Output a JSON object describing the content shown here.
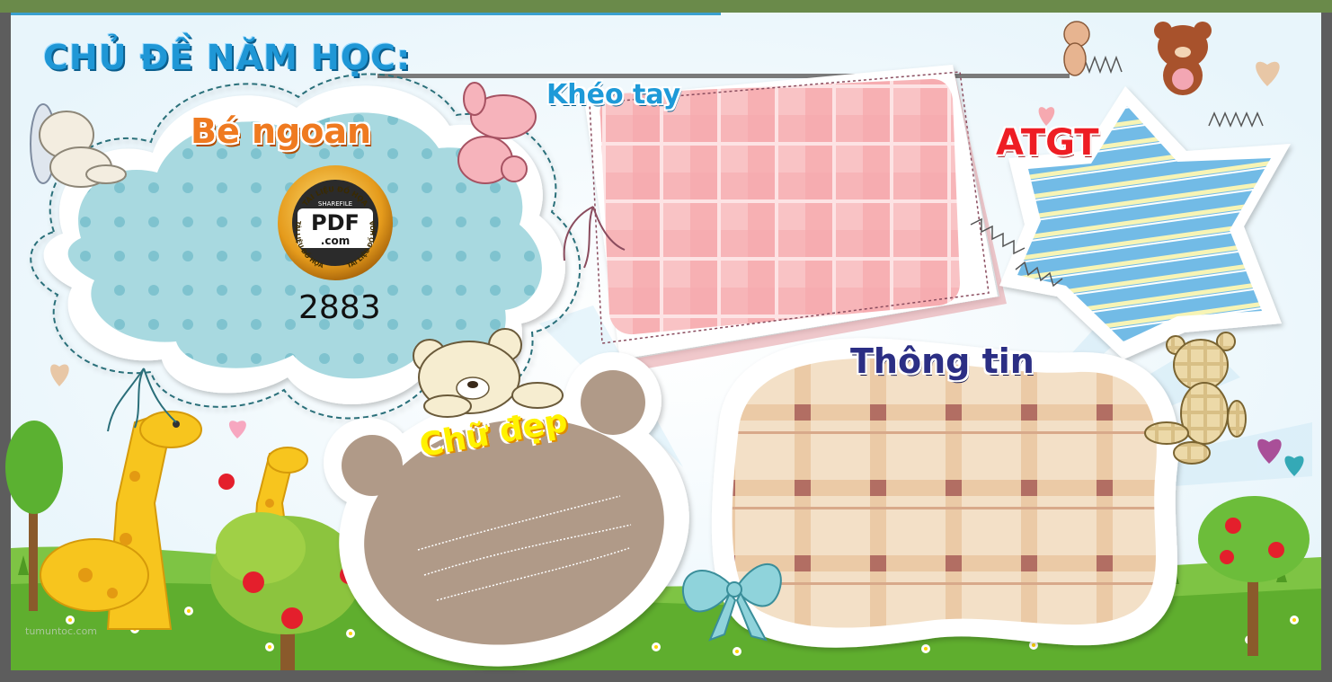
{
  "title": "CHỦ ĐỀ NĂM HỌC:",
  "sections": {
    "be_ngoan": "Bé ngoan",
    "kheo_tay": "Khéo tay",
    "atgt": "ATGT",
    "chu_dep": "Chữ đẹp",
    "thong_tin": "Thông tin"
  },
  "watermark": {
    "arc_top": "TÀI LIỆU ĐỒ HỌA",
    "arc_left": "TÀI LIỆU ĐỒ HỌA",
    "arc_right": "TÀI LIỆU ĐỒ HỌA",
    "brand_top": "SHAREFILE",
    "brand_main": "PDF",
    "brand_sub": ".com",
    "number": "2883"
  },
  "footer": "tumuntoc.com",
  "colors": {
    "title": "#1f97d6",
    "be_ngoan": "#ef7a20",
    "kheo_tay": "#1e9ad8",
    "atgt": "#ee1d24",
    "chu_dep": "#fff200",
    "thong_tin": "#2b2e84",
    "cloud": "#a8d9e0",
    "plaid_pink": "#f6a9ad",
    "star_blue": "#72bbe6",
    "bear_brown": "#b09a88",
    "plaid_beige": "#f3d9bd"
  }
}
